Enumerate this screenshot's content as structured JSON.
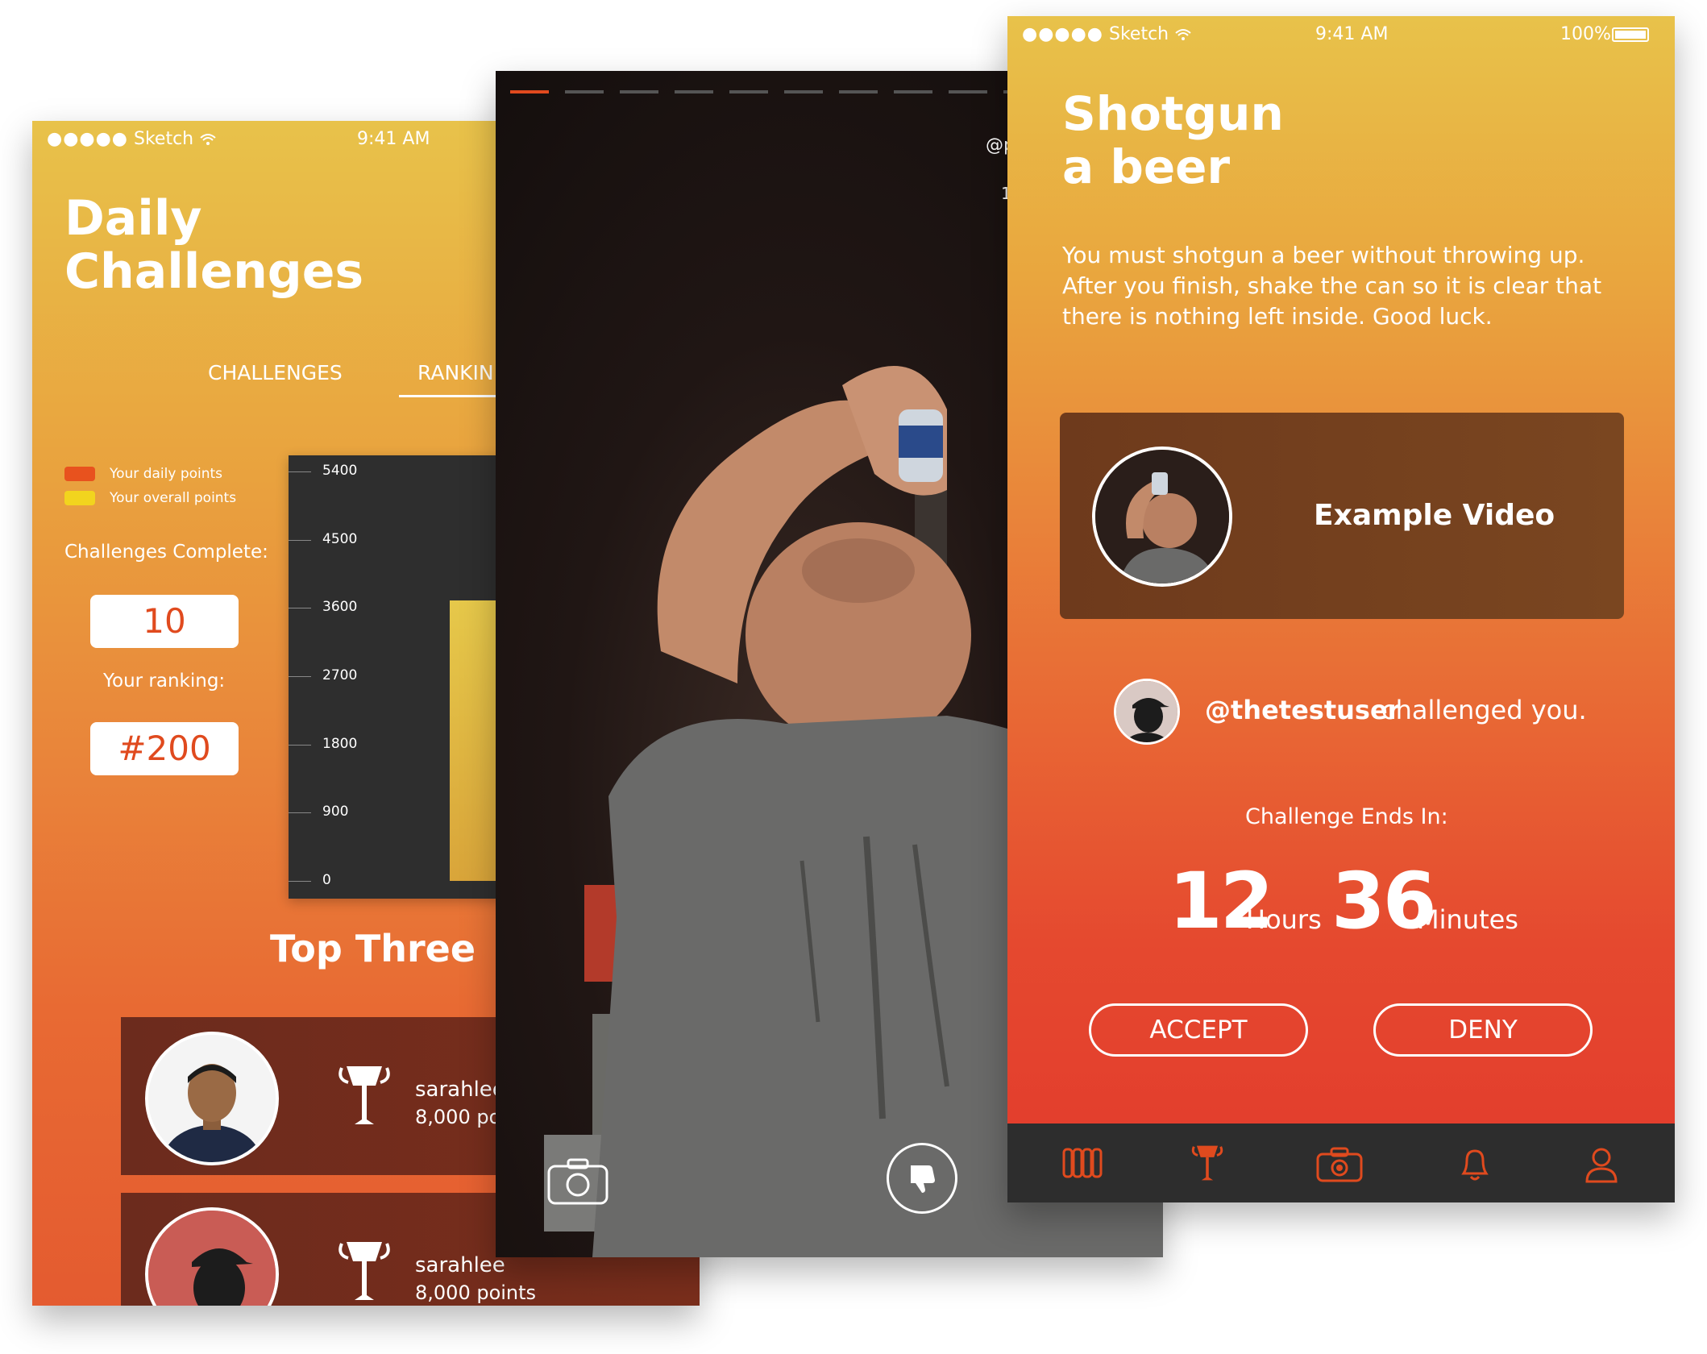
{
  "left_screen": {
    "status": {
      "carrier": "Sketch",
      "time": "9:41 AM"
    },
    "title_line1": "Daily",
    "title_line2": "Challenges",
    "tabs": [
      {
        "label": "CHALLENGES"
      },
      {
        "label": "RANKIN"
      }
    ],
    "legend": [
      {
        "label": "Your daily points",
        "color": "#E8521E"
      },
      {
        "label": "Your overall points",
        "color": "#F2D41E"
      }
    ],
    "challenges_complete_label": "Challenges Complete:",
    "challenges_complete_value": "10",
    "ranking_label": "Your ranking:",
    "ranking_value": "#200",
    "top_three_heading": "Top Three",
    "leaders": [
      {
        "name": "sarahlee",
        "points": "8,000 po"
      },
      {
        "name": "sarahlee",
        "points": "8,000 points"
      }
    ]
  },
  "chart_data": {
    "type": "bar",
    "title": "",
    "xlabel": "",
    "ylabel": "",
    "ylim": [
      0,
      5400
    ],
    "ticks": [
      "5400",
      "4500",
      "3600",
      "2700",
      "1800",
      "900",
      "0"
    ],
    "series": [
      {
        "name": "Your overall points",
        "values": [
          3700
        ]
      }
    ],
    "categories": [
      ""
    ]
  },
  "middle_screen": {
    "handle": "@p",
    "count": "1",
    "progress_segments": 10,
    "active_segment": 0
  },
  "right_screen": {
    "status": {
      "carrier": "Sketch",
      "time": "9:41 AM",
      "battery": "100%"
    },
    "title_line1": "Shotgun",
    "title_line2": "a beer",
    "description": "You must shotgun a beer without throwing up. After you finish, shake the can so it is clear that there is nothing left inside. Good luck.",
    "example_video_label": "Example Video",
    "challenger_handle": "@thetestuser",
    "challenger_text": "challenged you.",
    "ends_label": "Challenge Ends In:",
    "hours_value": "12",
    "hours_unit": "Hours",
    "minutes_value": "36",
    "minutes_unit": "Minutes",
    "accept_label": "ACCEPT",
    "deny_label": "DENY",
    "tabbar_icons": [
      "challenges-icon",
      "trophy-icon",
      "camera-icon",
      "bell-icon",
      "profile-icon"
    ],
    "accent": "#E04A1E"
  }
}
